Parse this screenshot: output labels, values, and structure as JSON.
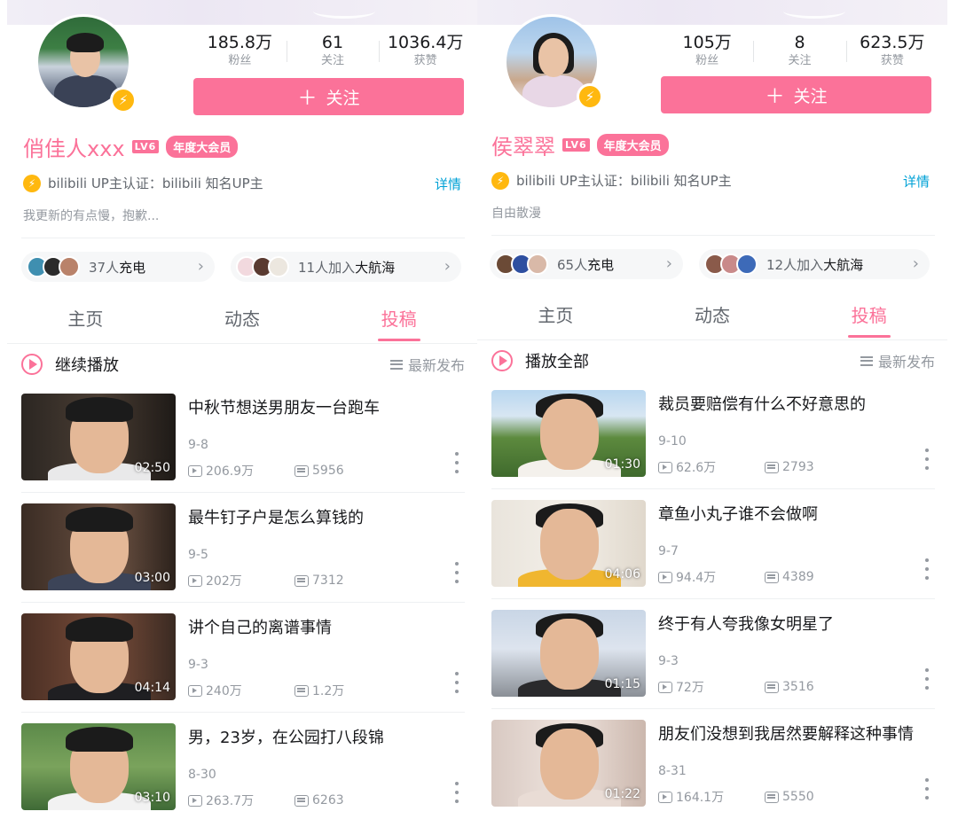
{
  "profiles": [
    {
      "stats": [
        {
          "num": "185.8万",
          "label": "粉丝"
        },
        {
          "num": "61",
          "label": "关注"
        },
        {
          "num": "1036.4万",
          "label": "获赞"
        }
      ],
      "follow_label": "关注",
      "name": "俏佳人xxx",
      "level": "LV6",
      "vip": "年度大会员",
      "cert": "bilibili UP主认证：bilibili 知名UP主",
      "detail": "详情",
      "sign": "我更新的有点慢，抱歉...",
      "charge": {
        "count": "37人",
        "label": "充电"
      },
      "fleet": {
        "count": "11人加入",
        "label": "大航海"
      },
      "tabs": [
        "主页",
        "动态",
        "投稿"
      ],
      "play_label": "继续播放",
      "sort_label": "最新发布",
      "videos": [
        {
          "title": "中秋节想送男朋友一台跑车",
          "date": "9-8",
          "views": "206.9万",
          "danmaku": "5956",
          "duration": "02:50"
        },
        {
          "title": "最牛钉子户是怎么算钱的",
          "date": "9-5",
          "views": "202万",
          "danmaku": "7312",
          "duration": "03:00"
        },
        {
          "title": "讲个自己的离谱事情",
          "date": "9-3",
          "views": "240万",
          "danmaku": "1.2万",
          "duration": "04:14"
        },
        {
          "title": "男，23岁，在公园打八段锦",
          "date": "8-30",
          "views": "263.7万",
          "danmaku": "6263",
          "duration": "03:10"
        }
      ]
    },
    {
      "stats": [
        {
          "num": "105万",
          "label": "粉丝"
        },
        {
          "num": "8",
          "label": "关注"
        },
        {
          "num": "623.5万",
          "label": "获赞"
        }
      ],
      "follow_label": "关注",
      "name": "侯翠翠",
      "level": "LV6",
      "vip": "年度大会员",
      "cert": "bilibili UP主认证：bilibili 知名UP主",
      "detail": "详情",
      "sign": "自由散漫",
      "charge": {
        "count": "65人",
        "label": "充电"
      },
      "fleet": {
        "count": "12人加入",
        "label": "大航海"
      },
      "tabs": [
        "主页",
        "动态",
        "投稿"
      ],
      "play_label": "播放全部",
      "sort_label": "最新发布",
      "videos": [
        {
          "title": "裁员要赔偿有什么不好意思的",
          "date": "9-10",
          "views": "62.6万",
          "danmaku": "2793",
          "duration": "01:30"
        },
        {
          "title": "章鱼小丸子谁不会做啊",
          "date": "9-7",
          "views": "94.4万",
          "danmaku": "4389",
          "duration": "04:06"
        },
        {
          "title": "终于有人夸我像女明星了",
          "date": "9-3",
          "views": "72万",
          "danmaku": "3516",
          "duration": "01:15"
        },
        {
          "title": "朋友们没想到我居然要解释这种事情",
          "date": "8-31",
          "views": "164.1万",
          "danmaku": "5550",
          "duration": "01:22"
        }
      ]
    }
  ],
  "colors": {
    "accent": "#fb7299",
    "link": "#00a1d6",
    "up_badge": "#ffb80f"
  }
}
